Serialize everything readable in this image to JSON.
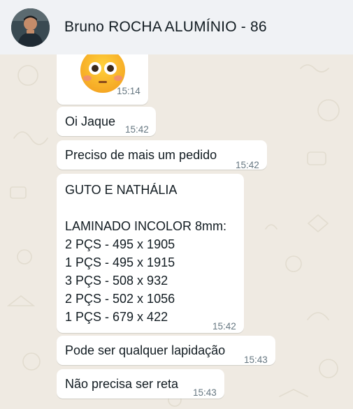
{
  "header": {
    "contact_name": "Bruno ROCHA ALUMÍNIO - 86",
    "avatar_icon": "person-avatar-icon"
  },
  "colors": {
    "header_bg": "#f0f2f5",
    "chat_bg": "#efeae2",
    "bubble_bg": "#ffffff",
    "text": "#111b21",
    "time": "#667781"
  },
  "messages": [
    {
      "type": "emoji",
      "emoji_icon": "flushed-face-icon",
      "time": "15:14"
    },
    {
      "type": "text",
      "text": "Oi Jaque",
      "time": "15:42"
    },
    {
      "type": "text",
      "text": "Preciso de mais um pedido",
      "time": "15:42"
    },
    {
      "type": "text",
      "lines": [
        "GUTO E NATHÁLIA",
        "",
        "LAMINADO INCOLOR 8mm:",
        "2 PÇS - 495 x 1905",
        "1 PÇS - 495 x 1915",
        "3 PÇS - 508 x 932",
        "2 PÇS - 502 x 1056",
        "1 PÇS - 679 x 422"
      ],
      "time": "15:42"
    },
    {
      "type": "text",
      "text": "Pode ser qualquer lapidação",
      "time": "15:43"
    },
    {
      "type": "text",
      "text": "Não precisa ser reta",
      "time": "15:43"
    }
  ]
}
